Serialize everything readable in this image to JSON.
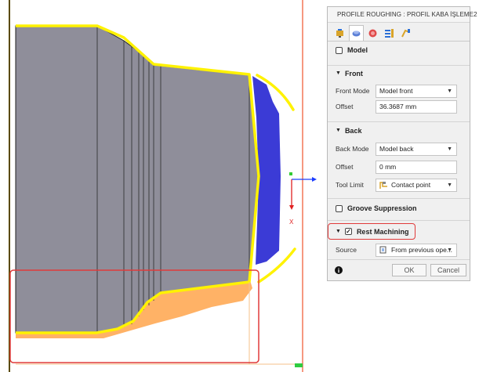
{
  "viewport": {
    "axis_x_label": "X",
    "colors": {
      "part_fill": "#8f8e9a",
      "part_edge": "#1f1f1f",
      "selection_yellow": "#fff200",
      "stock_orange": "#ffb266",
      "rest_blue": "#3b3bd6",
      "tool_red": "#f0552d",
      "highlight_red": "#e03a3a"
    }
  },
  "panel": {
    "title": "PROFILE ROUGHING : PROFIL KABA İŞLEME2",
    "tabs": [
      "tool-tab-icon",
      "geometry-tab-icon",
      "heights-tab-icon",
      "passes-tab-icon",
      "linking-tab-icon"
    ],
    "model": {
      "label": "Model",
      "checked": false
    },
    "front": {
      "header": "Front",
      "mode_label": "Front Mode",
      "mode_value": "Model front",
      "offset_label": "Offset",
      "offset_value": "36.3687 mm"
    },
    "back": {
      "header": "Back",
      "mode_label": "Back Mode",
      "mode_value": "Model back",
      "offset_label": "Offset",
      "offset_value": "0 mm",
      "tool_limit_label": "Tool Limit",
      "tool_limit_value": "Contact point"
    },
    "groove": {
      "label": "Groove Suppression",
      "checked": false
    },
    "rest": {
      "label": "Rest Machining",
      "checked": true,
      "source_label": "Source",
      "source_value": "From previous ope..."
    },
    "buttons": {
      "ok": "OK",
      "cancel": "Cancel"
    }
  }
}
